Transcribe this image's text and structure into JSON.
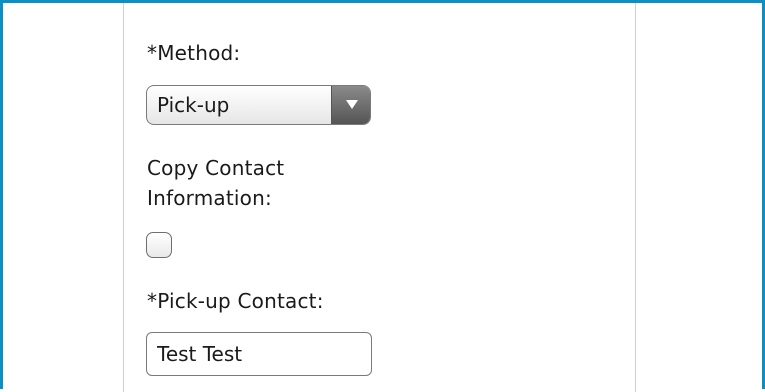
{
  "form": {
    "method_label": "*Method:",
    "method_value": "Pick-up",
    "copy_contact_label": "Copy Contact Information:",
    "copy_contact_checked": false,
    "pickup_contact_label": "*Pick-up Contact:",
    "pickup_contact_value": "Test Test"
  },
  "colors": {
    "frame_border": "#0e8fc4",
    "column_divider": "#cfcfcf",
    "dropdown_arrow_bg": "#666666"
  },
  "icons": {
    "dropdown": "caret-down-icon"
  }
}
